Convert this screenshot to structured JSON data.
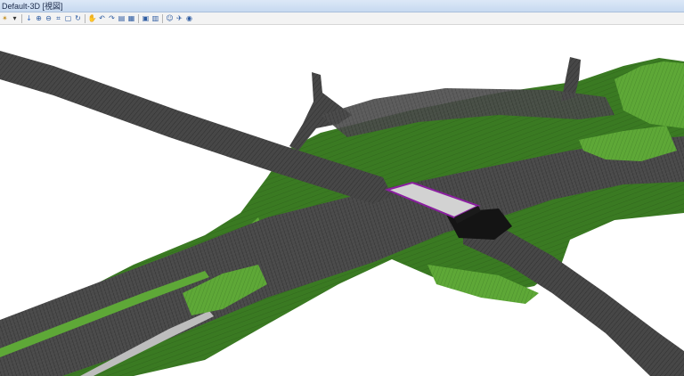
{
  "window": {
    "title": "Default-3D [視図]"
  },
  "toolbar": {
    "tools": [
      {
        "name": "element-selection-icon",
        "glyph": "✴",
        "color": "#c08a1a"
      },
      {
        "name": "dropdown-arrow-icon",
        "glyph": "▾",
        "color": "#333333"
      },
      {
        "name": "update-view-icon",
        "glyph": "↓",
        "color": "#3a6fc4"
      },
      {
        "name": "zoom-in-icon",
        "glyph": "⊕",
        "color": "#2c5aa0"
      },
      {
        "name": "zoom-out-icon",
        "glyph": "⊖",
        "color": "#2c5aa0"
      },
      {
        "name": "window-area-icon",
        "glyph": "⌗",
        "color": "#2c5aa0"
      },
      {
        "name": "fit-view-icon",
        "glyph": "▢",
        "color": "#2c5aa0"
      },
      {
        "name": "rotate-view-icon",
        "glyph": "↻",
        "color": "#2c5aa0"
      },
      {
        "name": "pan-view-icon",
        "glyph": "✋",
        "color": "#555555"
      },
      {
        "name": "view-previous-icon",
        "glyph": "↶",
        "color": "#2c5aa0"
      },
      {
        "name": "view-next-icon",
        "glyph": "↷",
        "color": "#2c5aa0"
      },
      {
        "name": "copy-view-icon",
        "glyph": "▤",
        "color": "#2c5aa0"
      },
      {
        "name": "view-attributes-icon",
        "glyph": "▦",
        "color": "#2c5aa0"
      },
      {
        "name": "display-style-icon",
        "glyph": "▣",
        "color": "#2c5aa0"
      },
      {
        "name": "camera-icon",
        "glyph": "▥",
        "color": "#2c5aa0"
      },
      {
        "name": "walk-icon",
        "glyph": "☺",
        "color": "#2c5aa0"
      },
      {
        "name": "fly-icon",
        "glyph": "✈",
        "color": "#2c5aa0"
      },
      {
        "name": "render-icon",
        "glyph": "◉",
        "color": "#2c5aa0"
      }
    ]
  },
  "scene": {
    "colors": {
      "background": "#ffffff",
      "terrain": "#3a7a22",
      "terrain_light": "#5ea837",
      "road": "#4a4a4a",
      "road_dark": "#2e2e2e",
      "mesh": "#1e1e1e",
      "bridge_deck": "#d2d2d2",
      "bridge_outline": "#8b1fa0"
    }
  }
}
